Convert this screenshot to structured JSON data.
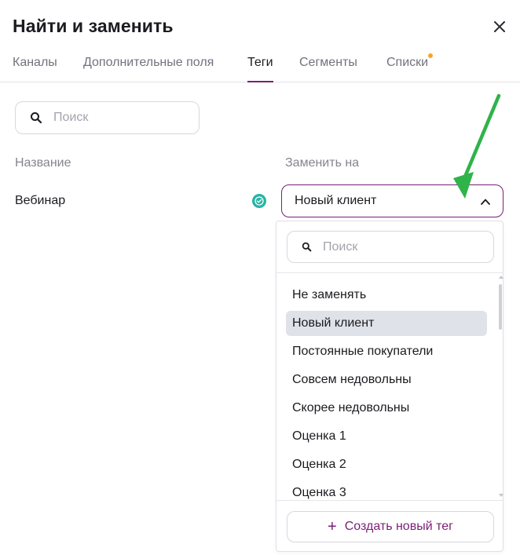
{
  "dialog": {
    "title": "Найти и заменить"
  },
  "tabs": [
    {
      "label": "Каналы",
      "active": false
    },
    {
      "label": "Дополнительные поля",
      "active": false
    },
    {
      "label": "Теги",
      "active": true
    },
    {
      "label": "Сегменты",
      "active": false
    },
    {
      "label": "Списки",
      "active": false,
      "has_notification_dot": true
    }
  ],
  "search": {
    "placeholder": "Поиск"
  },
  "columns": {
    "name": "Название",
    "replace_with": "Заменить на"
  },
  "row": {
    "name": "Вебинар",
    "selected_value": "Новый клиент"
  },
  "dropdown": {
    "search_placeholder": "Поиск",
    "options": [
      "Не заменять",
      "Новый клиент",
      "Постоянные покупатели",
      "Совсем недовольны",
      "Скорее недовольны",
      "Оценка 1",
      "Оценка 2",
      "Оценка 3"
    ],
    "selected_option": "Новый клиент",
    "create_label": "Создать новый тег"
  },
  "colors": {
    "accent": "#7a1f76",
    "success": "#26b5a5",
    "notification_dot": "#f5a623",
    "annotation_arrow": "#2fb34a"
  }
}
